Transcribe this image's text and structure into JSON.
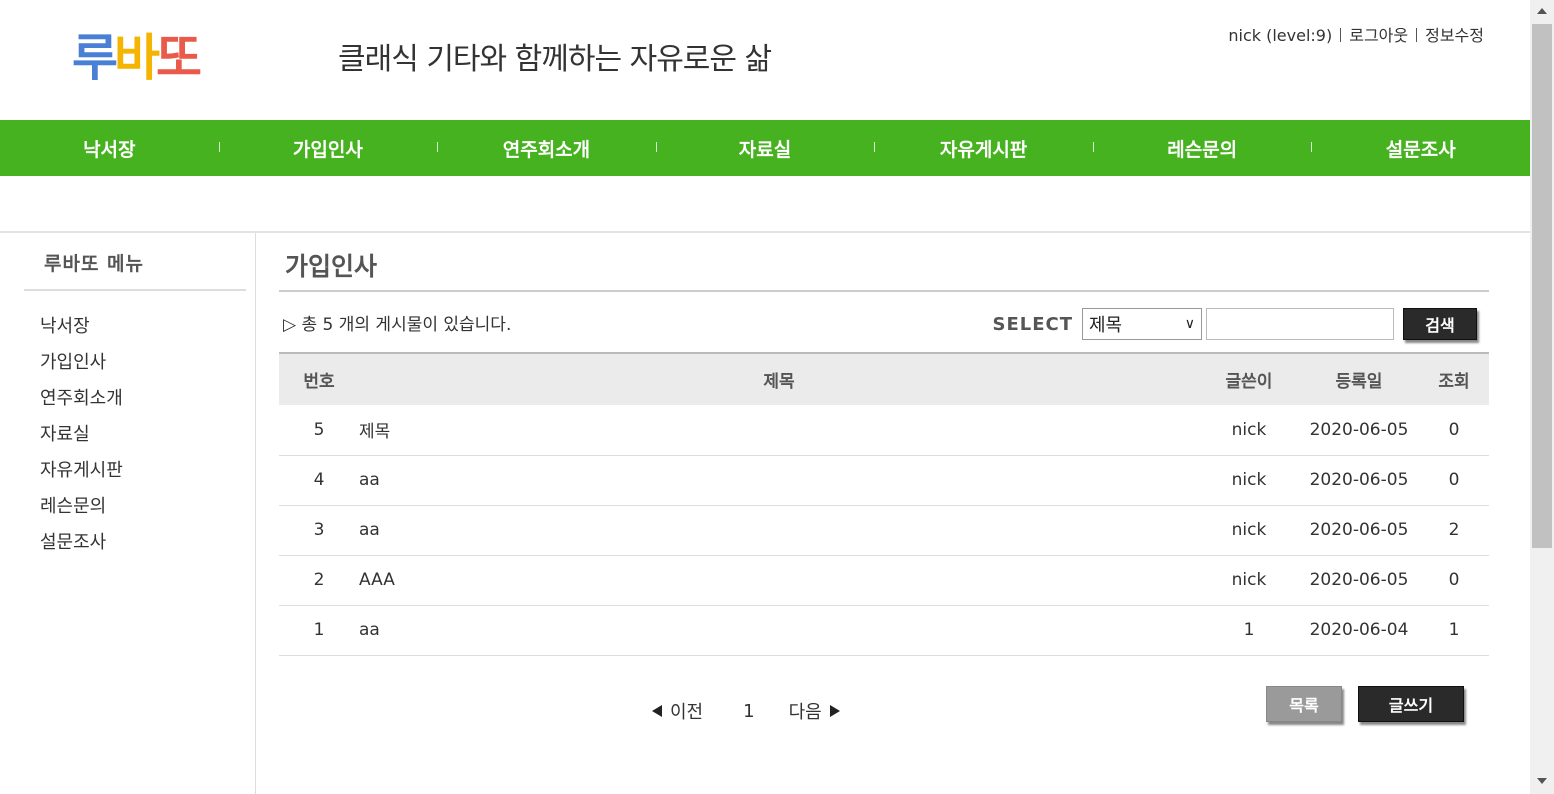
{
  "header": {
    "logo_chars": [
      {
        "char": "루",
        "color": "#4a7fd6"
      },
      {
        "char": "바",
        "color": "#f5b400"
      },
      {
        "char": "또",
        "color": "#ea5a4a"
      }
    ],
    "tagline": "클래식 기타와 함께하는 자유로운 삶",
    "user": "nick (level:9)",
    "logout": "로그아웃",
    "edit_profile": "정보수정"
  },
  "nav": {
    "items": [
      "낙서장",
      "가입인사",
      "연주회소개",
      "자료실",
      "자유게시판",
      "레슨문의",
      "설문조사"
    ],
    "color": "#47b21f"
  },
  "sidebar": {
    "title": "루바또 메뉴",
    "items": [
      "낙서장",
      "가입인사",
      "연주회소개",
      "자료실",
      "자유게시판",
      "레슨문의",
      "설문조사"
    ]
  },
  "board": {
    "title": "가입인사",
    "count_text": "▷ 총 5 개의 게시물이 있습니다.",
    "search": {
      "label": "SELECT",
      "selected": "제목",
      "value": "",
      "button": "검색"
    },
    "columns": [
      "번호",
      "제목",
      "글쓴이",
      "등록일",
      "조회"
    ],
    "rows": [
      {
        "no": "5",
        "title": "제목",
        "writer": "nick",
        "date": "2020-06-05",
        "views": "0"
      },
      {
        "no": "4",
        "title": "aa",
        "writer": "nick",
        "date": "2020-06-05",
        "views": "0"
      },
      {
        "no": "3",
        "title": "aa",
        "writer": "nick",
        "date": "2020-06-05",
        "views": "2"
      },
      {
        "no": "2",
        "title": "AAA",
        "writer": "nick",
        "date": "2020-06-05",
        "views": "0"
      },
      {
        "no": "1",
        "title": "aa",
        "writer": "1",
        "date": "2020-06-04",
        "views": "1"
      }
    ]
  },
  "pager": {
    "prev": "이전",
    "current": "1",
    "next": "다음"
  },
  "buttons": {
    "list": "목록",
    "write": "글쓰기"
  }
}
